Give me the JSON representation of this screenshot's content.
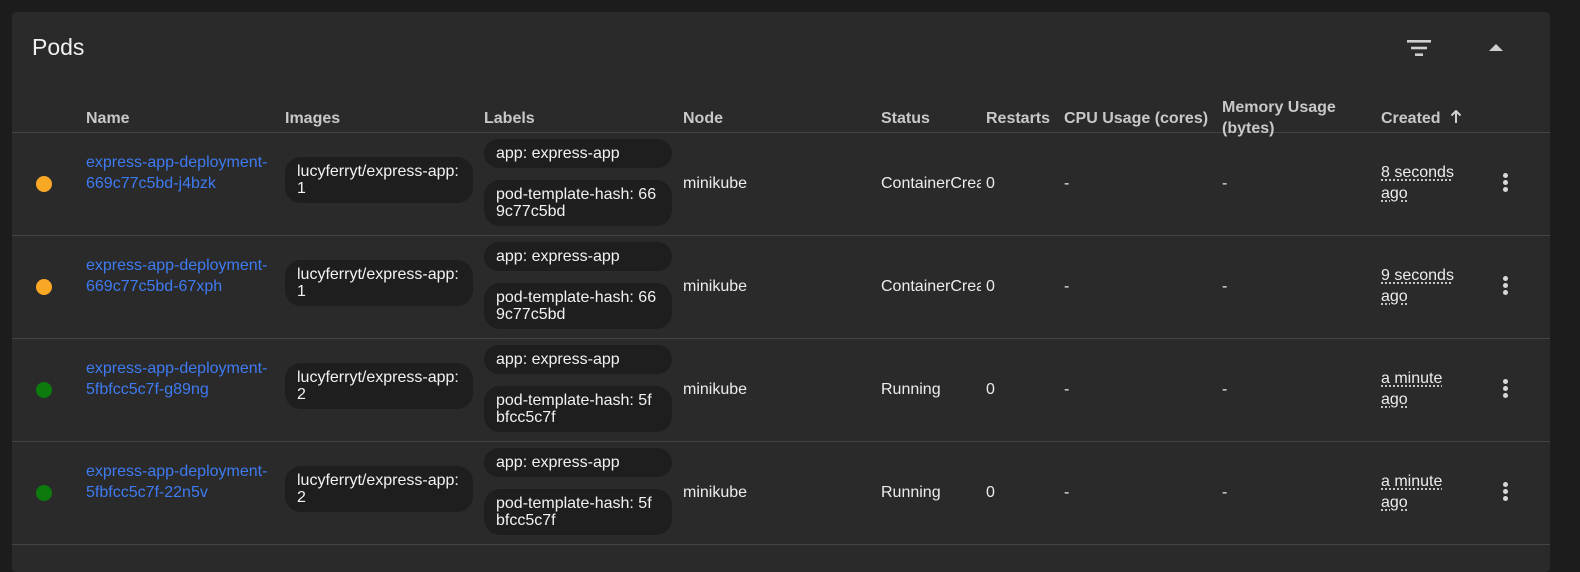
{
  "card": {
    "title": "Pods",
    "filter_icon": "filter-list-icon",
    "collapse_icon": "chevron-up-icon"
  },
  "columns": {
    "name": "Name",
    "images": "Images",
    "labels": "Labels",
    "node": "Node",
    "status": "Status",
    "restarts": "Restarts",
    "cpu": "CPU Usage (cores)",
    "memory": "Memory Usage (bytes)",
    "created": "Created",
    "created_sort_icon": "arrow-up-icon"
  },
  "status_colors": {
    "pending": "#f9a825",
    "running": "#0d7a0d"
  },
  "rows": [
    {
      "name": "express-app-deployment-669c77c5bd-j4bzk",
      "image": "lucyferryt/express-app:1",
      "label_app": "app: express-app",
      "label_hash": "pod-template-hash: 669c77c5bd",
      "node": "minikube",
      "status": "ContainerCreating",
      "restarts": "0",
      "cpu": "-",
      "memory": "-",
      "created": "8 seconds ago",
      "state": "pending"
    },
    {
      "name": "express-app-deployment-669c77c5bd-67xph",
      "image": "lucyferryt/express-app:1",
      "label_app": "app: express-app",
      "label_hash": "pod-template-hash: 669c77c5bd",
      "node": "minikube",
      "status": "ContainerCreating",
      "restarts": "0",
      "cpu": "-",
      "memory": "-",
      "created": "9 seconds ago",
      "state": "pending"
    },
    {
      "name": "express-app-deployment-5fbfcc5c7f-g89ng",
      "image": "lucyferryt/express-app:2",
      "label_app": "app: express-app",
      "label_hash": "pod-template-hash: 5fbfcc5c7f",
      "node": "minikube",
      "status": "Running",
      "restarts": "0",
      "cpu": "-",
      "memory": "-",
      "created": "a minute ago",
      "state": "running"
    },
    {
      "name": "express-app-deployment-5fbfcc5c7f-22n5v",
      "image": "lucyferryt/express-app:2",
      "label_app": "app: express-app",
      "label_hash": "pod-template-hash: 5fbfcc5c7f",
      "node": "minikube",
      "status": "Running",
      "restarts": "0",
      "cpu": "-",
      "memory": "-",
      "created": "a minute ago",
      "state": "running"
    }
  ]
}
